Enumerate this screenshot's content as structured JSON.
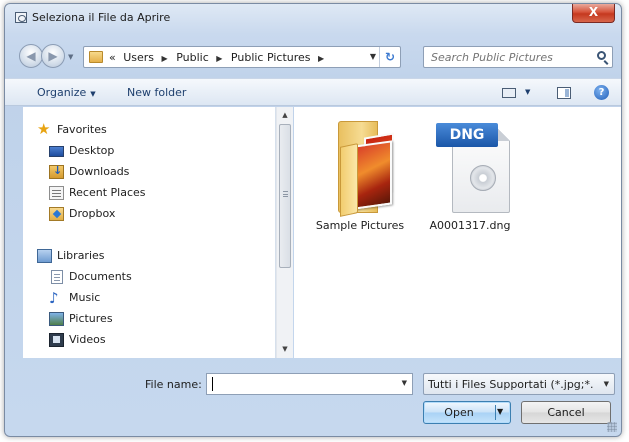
{
  "window": {
    "title": "Seleziona il File da Aprire",
    "close_glyph": "X"
  },
  "address": {
    "breadcrumbs": [
      "«",
      "Users",
      "Public",
      "Public Pictures"
    ],
    "separator": "▶"
  },
  "search": {
    "placeholder": "Search Public Pictures"
  },
  "toolbar": {
    "organize": "Organize",
    "new_folder": "New folder",
    "help": "?"
  },
  "nav": {
    "favorites_header": "Favorites",
    "favorites": [
      "Desktop",
      "Downloads",
      "Recent Places",
      "Dropbox"
    ],
    "libraries_header": "Libraries",
    "libraries": [
      "Documents",
      "Music",
      "Pictures",
      "Videos"
    ]
  },
  "files": [
    {
      "name": "Sample Pictures",
      "type": "folder"
    },
    {
      "name": "A0001317.dng",
      "type": "dng",
      "badge": "DNG"
    }
  ],
  "bottom": {
    "file_name_label": "File name:",
    "file_name_value": "",
    "filter": "Tutti i Files Supportati (*.jpg;*.j|",
    "open": "Open",
    "cancel": "Cancel"
  },
  "icons": [
    "window-icon",
    "close-icon",
    "back-icon",
    "forward-icon",
    "folder-icon",
    "refresh-icon",
    "search-icon",
    "view-icon",
    "preview-pane-icon",
    "help-icon",
    "star-icon",
    "desktop-icon",
    "downloads-icon",
    "recent-places-icon",
    "dropbox-icon",
    "libraries-icon",
    "documents-icon",
    "music-icon",
    "pictures-icon",
    "videos-icon"
  ],
  "colors": {
    "accent": "#1e3f6e",
    "close_red": "#c5381f",
    "dng_blue": "#1a56a8"
  }
}
